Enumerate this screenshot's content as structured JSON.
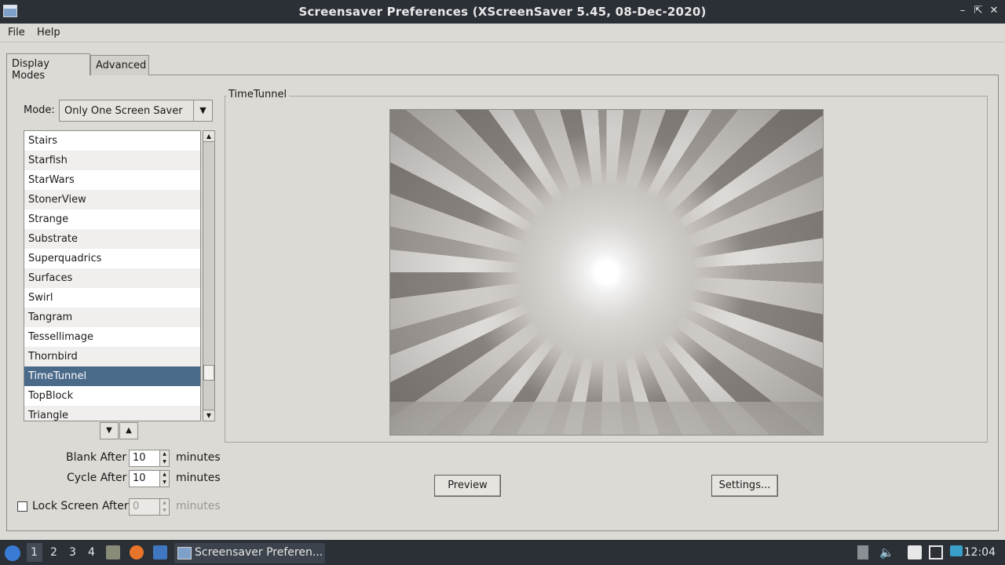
{
  "window": {
    "title": "Screensaver Preferences  (XScreenSaver 5.45, 08-Dec-2020)"
  },
  "menu": {
    "file": "File",
    "help": "Help"
  },
  "tabs": {
    "display_modes": "Display Modes",
    "advanced": "Advanced"
  },
  "mode": {
    "label": "Mode:",
    "value": "Only One Screen Saver"
  },
  "savers": [
    "Stairs",
    "Starfish",
    "StarWars",
    "StonerView",
    "Strange",
    "Substrate",
    "Superquadrics",
    "Surfaces",
    "Swirl",
    "Tangram",
    "Tessellimage",
    "Thornbird",
    "TimeTunnel",
    "TopBlock",
    "Triangle"
  ],
  "selected_saver": "TimeTunnel",
  "preview": {
    "frame_title": "TimeTunnel",
    "preview_button": "Preview",
    "settings_button": "Settings..."
  },
  "timing": {
    "blank_label": "Blank After",
    "blank_value": "10",
    "blank_unit": "minutes",
    "cycle_label": "Cycle After",
    "cycle_value": "10",
    "cycle_unit": "minutes",
    "lock_label": "Lock Screen After",
    "lock_value": "0",
    "lock_unit": "minutes"
  },
  "taskbar": {
    "workspaces": [
      "1",
      "2",
      "3",
      "4"
    ],
    "window_title": "Screensaver Preferen...",
    "clock": "12:04"
  },
  "colors": {
    "selection": "#4a6a8a",
    "titlebar": "#2b2f36",
    "panel": "#dcdad5"
  }
}
